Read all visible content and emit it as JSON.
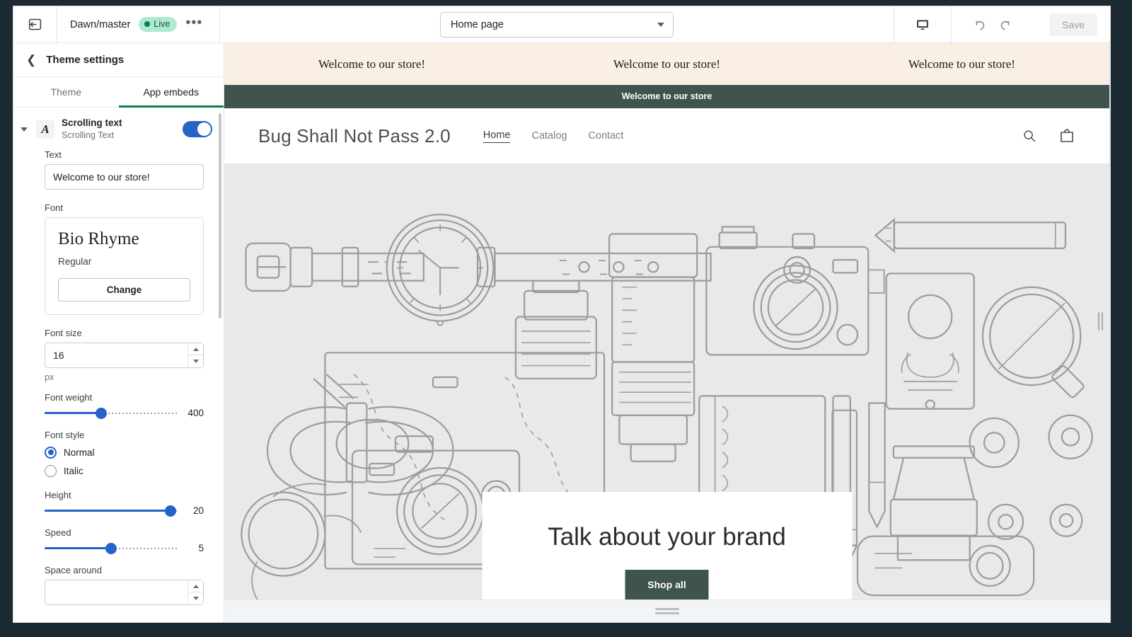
{
  "topbar": {
    "exit_icon": "exit-arrow-icon",
    "theme_name": "Dawn/master",
    "live_label": "Live",
    "more_label": "•••",
    "page_selector": {
      "value": "Home page",
      "caret_icon": "chevron-down-icon"
    },
    "device_icon": "desktop-icon",
    "undo_icon": "undo-arrow-icon",
    "redo_icon": "redo-arrow-icon",
    "save_label": "Save"
  },
  "sidebar": {
    "back_icon": "chevron-left-icon",
    "title": "Theme settings",
    "tabs": [
      {
        "label": "Theme",
        "active": false
      },
      {
        "label": "App embeds",
        "active": true
      }
    ],
    "embed": {
      "caret_icon": "caret-down-icon",
      "app_icon": "letter-a-font-icon",
      "title": "Scrolling text",
      "subtitle": "Scrolling Text",
      "enabled": true
    },
    "settings": {
      "text": {
        "label": "Text",
        "value": "Welcome to our store!"
      },
      "font": {
        "label": "Font",
        "family": "Bio Rhyme",
        "weight_name": "Regular",
        "change_label": "Change"
      },
      "font_size": {
        "label": "Font size",
        "value": "16",
        "unit": "px"
      },
      "font_weight": {
        "label": "Font weight",
        "value": "400",
        "percent": 43
      },
      "font_style": {
        "label": "Font style",
        "options": [
          {
            "label": "Normal",
            "selected": true
          },
          {
            "label": "Italic",
            "selected": false
          }
        ]
      },
      "height": {
        "label": "Height",
        "value": "20",
        "percent": 95
      },
      "speed": {
        "label": "Speed",
        "value": "5",
        "percent": 50
      },
      "space_around": {
        "label": "Space around"
      }
    }
  },
  "preview": {
    "marquee": {
      "items": [
        "Welcome to our store!",
        "Welcome to our store!",
        "Welcome to our store!"
      ],
      "background": "#faefe3"
    },
    "announcement": {
      "text": "Welcome to our store",
      "background": "#40544f"
    },
    "store": {
      "logo": "Bug Shall Not Pass 2.0",
      "nav": [
        {
          "label": "Home",
          "active": true
        },
        {
          "label": "Catalog",
          "active": false
        },
        {
          "label": "Contact",
          "active": false
        }
      ],
      "search_icon": "search-icon",
      "cart_icon": "shopping-bag-icon"
    },
    "hero": {
      "title": "Talk about your brand",
      "button_label": "Shop all",
      "button_color": "#40544f",
      "background": "#e9e9e7"
    },
    "resize_handle_vertical": "column-resize-handle",
    "resize_handle_horizontal": "row-resize-handle"
  }
}
